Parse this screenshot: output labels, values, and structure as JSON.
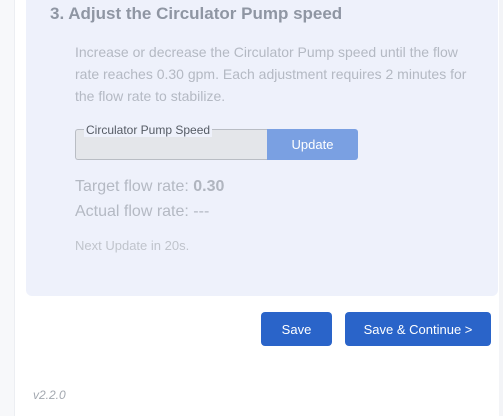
{
  "step": {
    "title": "3. Adjust the Circulator Pump speed",
    "description": "Increase or decrease the Circulator Pump speed until the flow rate reaches 0.30 gpm. Each adjustment requires 2 minutes for the flow rate to stabilize."
  },
  "pump_speed": {
    "legend": "Circulator Pump Speed",
    "value": "",
    "update_label": "Update"
  },
  "flow": {
    "target_label": "Target flow rate: ",
    "target_value": "0.30",
    "actual_label": "Actual flow rate: ",
    "actual_value": "---"
  },
  "next_update": "Next Update in 20s.",
  "actions": {
    "save_label": "Save",
    "save_continue_label": "Save & Continue >"
  },
  "version": "v2.2.0",
  "colors": {
    "accent": "#2a64c9",
    "accent_disabled": "#7aa0e2",
    "card_background": "#eef1fb"
  }
}
